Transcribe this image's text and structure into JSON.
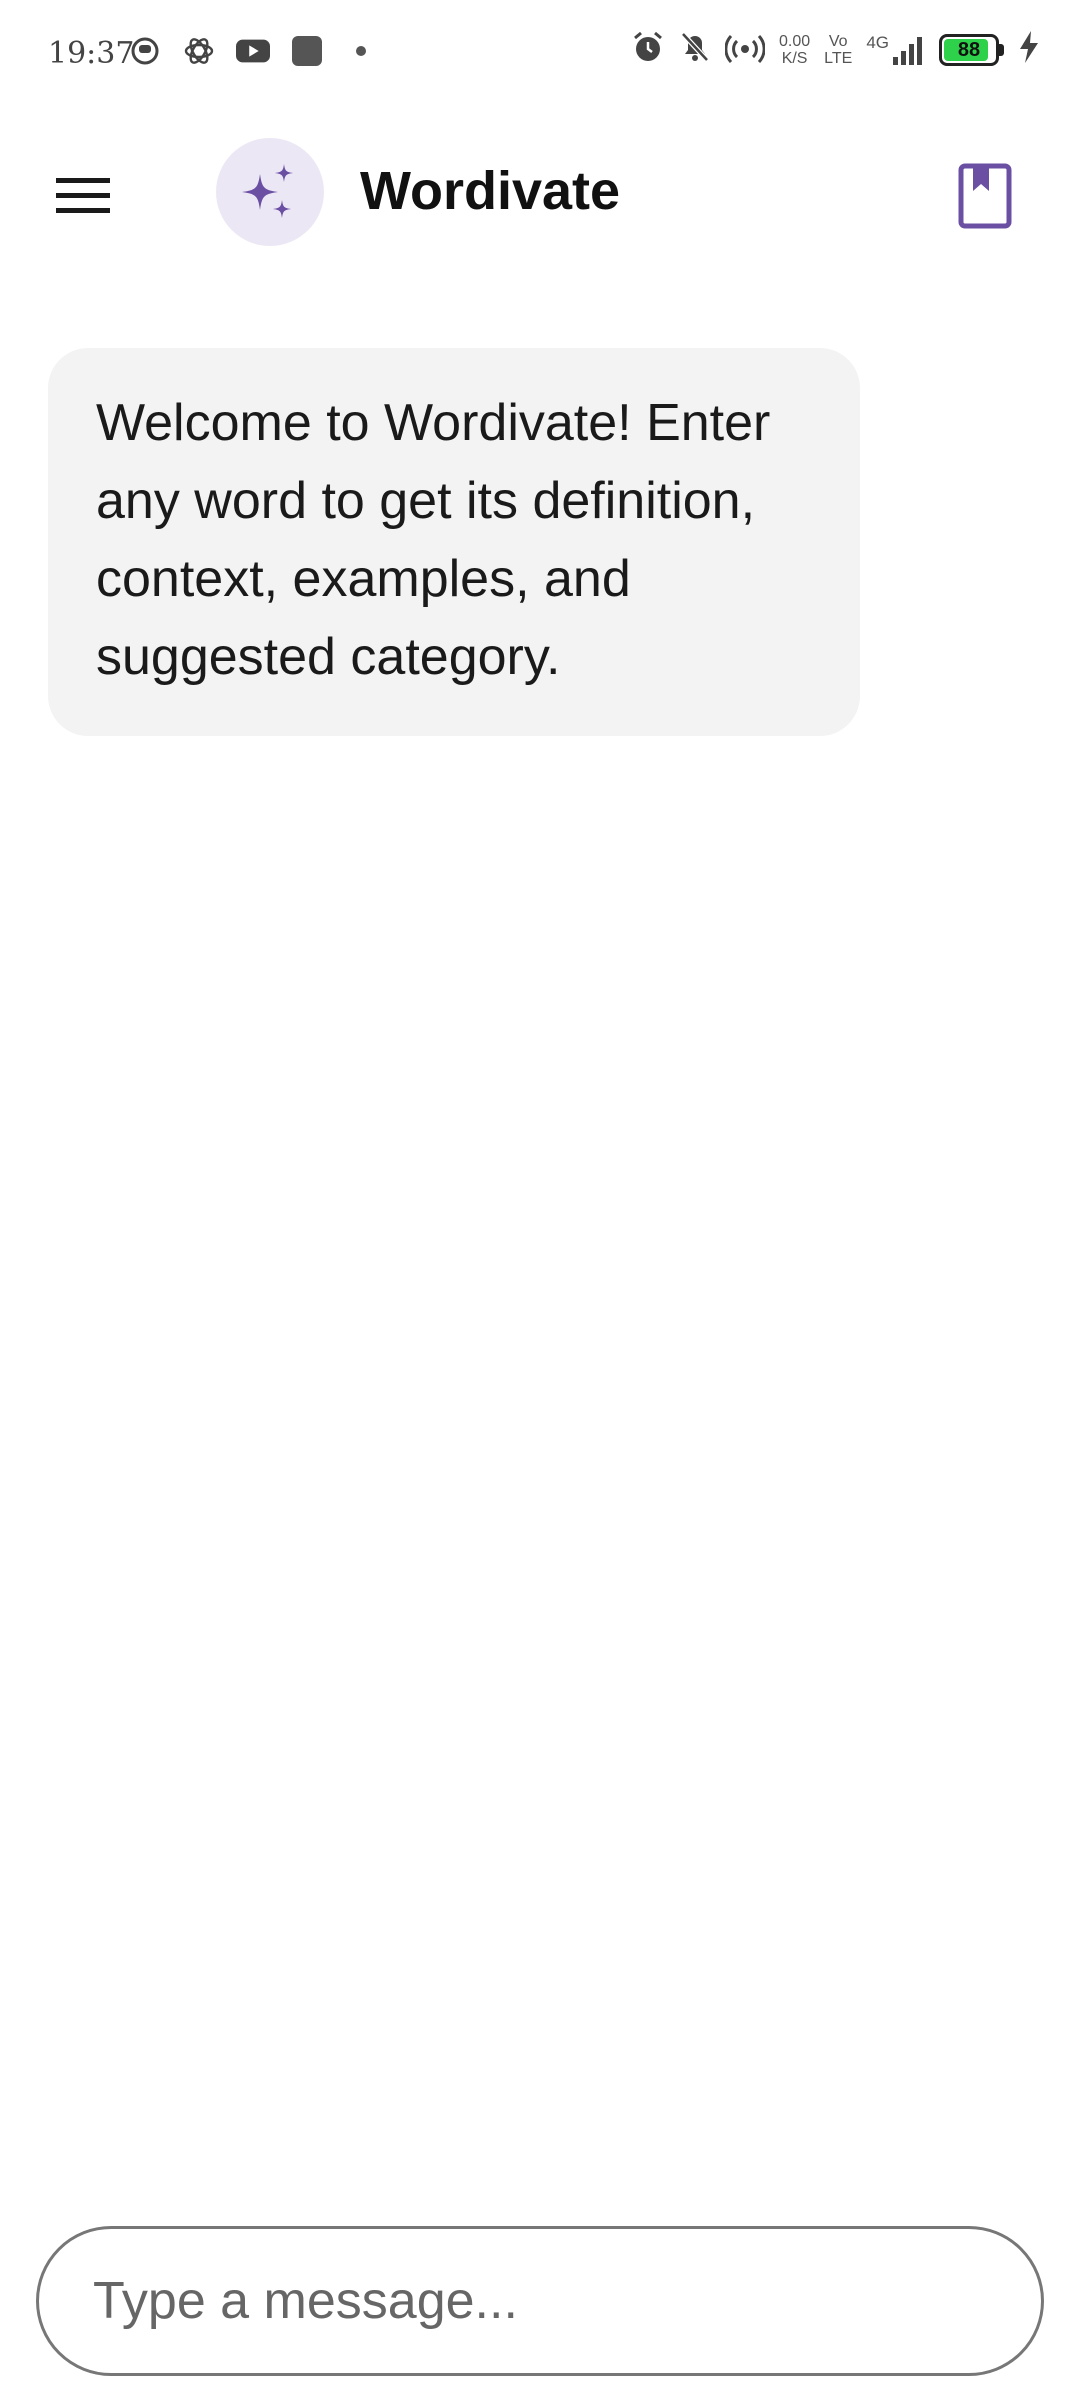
{
  "status_bar": {
    "time": "19:37",
    "net_speed_value": "0.00",
    "net_speed_unit": "K/S",
    "volte_top": "Vo",
    "volte_bottom": "LTE",
    "network_type": "4G",
    "battery_level": "88",
    "battery_color": "#2ed24a",
    "icons": [
      "app-notification-icon",
      "chatgpt-icon",
      "youtube-icon",
      "app-square-icon",
      "dot-icon",
      "alarm-icon",
      "bell-off-icon",
      "hotspot-icon",
      "signal-icon",
      "charging-icon"
    ]
  },
  "app_bar": {
    "title": "Wordivate",
    "accent_color": "#6a4fa3",
    "icons": [
      "menu-icon",
      "sparkle-icon",
      "bookmark-book-icon"
    ]
  },
  "chat": {
    "messages": [
      {
        "sender": "bot",
        "text": "Welcome to Wordivate! Enter any word to get its definition, context, examples, and suggested category."
      }
    ]
  },
  "composer": {
    "value": "",
    "placeholder": "Type a message..."
  }
}
